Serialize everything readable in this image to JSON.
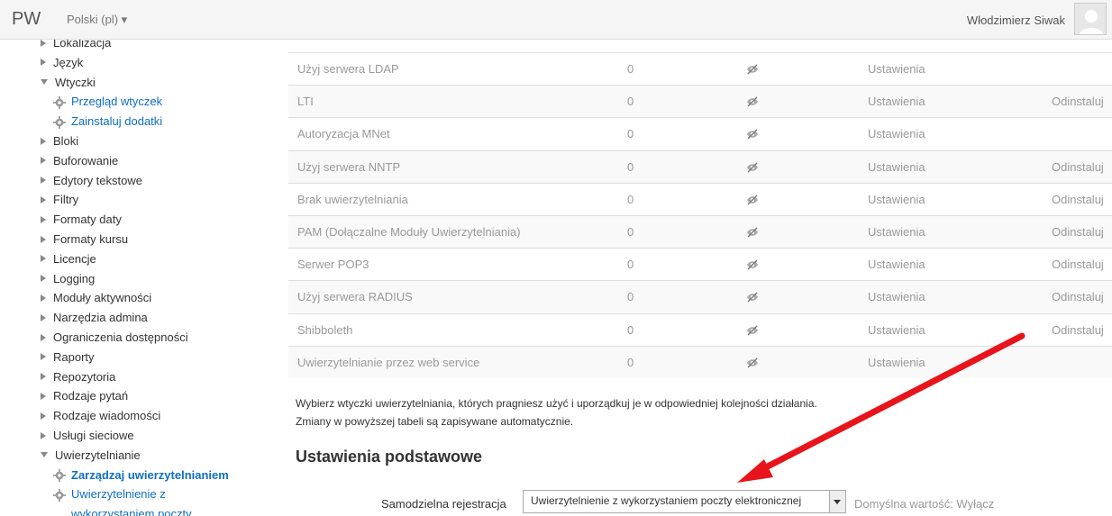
{
  "navbar": {
    "brand": "PW",
    "language": "Polski (pl) ▾",
    "user_name": "Włodzimierz Siwak"
  },
  "sidebar": {
    "items": [
      {
        "label": "Lokalizacja",
        "state": "collapsed"
      },
      {
        "label": "Język",
        "state": "collapsed"
      },
      {
        "label": "Wtyczki",
        "state": "expanded"
      },
      {
        "label": "Przegląd wtyczek",
        "state": "link"
      },
      {
        "label": "Zainstaluj dodatki",
        "state": "link"
      },
      {
        "label": "Bloki",
        "state": "collapsed"
      },
      {
        "label": "Buforowanie",
        "state": "collapsed"
      },
      {
        "label": "Edytory tekstowe",
        "state": "collapsed"
      },
      {
        "label": "Filtry",
        "state": "collapsed"
      },
      {
        "label": "Formaty daty",
        "state": "collapsed"
      },
      {
        "label": "Formaty kursu",
        "state": "collapsed"
      },
      {
        "label": "Licencje",
        "state": "collapsed"
      },
      {
        "label": "Logging",
        "state": "collapsed"
      },
      {
        "label": "Moduły aktywności",
        "state": "collapsed"
      },
      {
        "label": "Narzędzia admina",
        "state": "collapsed"
      },
      {
        "label": "Ograniczenia dostępności",
        "state": "collapsed"
      },
      {
        "label": "Raporty",
        "state": "collapsed"
      },
      {
        "label": "Repozytoria",
        "state": "collapsed"
      },
      {
        "label": "Rodzaje pytań",
        "state": "collapsed"
      },
      {
        "label": "Rodzaje wiadomości",
        "state": "collapsed"
      },
      {
        "label": "Usługi sieciowe",
        "state": "collapsed"
      },
      {
        "label": "Uwierzytelnianie",
        "state": "expanded"
      },
      {
        "label": "Zarządzaj uwierzytelnianiem",
        "state": "active"
      },
      {
        "label": "Uwierzytelnienie z",
        "state": "link"
      },
      {
        "label": "wykorzystaniem poczty",
        "state": "link-continued"
      }
    ]
  },
  "auth_table": {
    "rows": [
      {
        "name": "Użyj serwera LDAP",
        "count": "0",
        "settings": "Ustawienia",
        "uninstall": ""
      },
      {
        "name": "LTI",
        "count": "0",
        "settings": "Ustawienia",
        "uninstall": "Odinstaluj"
      },
      {
        "name": "Autoryzacja MNet",
        "count": "0",
        "settings": "Ustawienia",
        "uninstall": ""
      },
      {
        "name": "Użyj serwera NNTP",
        "count": "0",
        "settings": "Ustawienia",
        "uninstall": "Odinstaluj"
      },
      {
        "name": "Brak uwierzytelniania",
        "count": "0",
        "settings": "Ustawienia",
        "uninstall": "Odinstaluj"
      },
      {
        "name": "PAM (Dołączalne Moduły Uwierzytelniania)",
        "count": "0",
        "settings": "Ustawienia",
        "uninstall": "Odinstaluj"
      },
      {
        "name": "Serwer POP3",
        "count": "0",
        "settings": "Ustawienia",
        "uninstall": "Odinstaluj"
      },
      {
        "name": "Użyj serwera RADIUS",
        "count": "0",
        "settings": "Ustawienia",
        "uninstall": "Odinstaluj"
      },
      {
        "name": "Shibboleth",
        "count": "0",
        "settings": "Ustawienia",
        "uninstall": "Odinstaluj"
      },
      {
        "name": "Uwierzytelnianie przez web service",
        "count": "0",
        "settings": "Ustawienia",
        "uninstall": ""
      }
    ],
    "enable_icon": "eye-slash-icon"
  },
  "notes": {
    "line1": "Wybierz wtyczki uwierzytelniania, których pragniesz użyć i uporządkuj je w odpowiedniej kolejności działania.",
    "line2": "Zmiany w powyższej tabeli są zapisywane automatycznie."
  },
  "basic_settings": {
    "heading": "Ustawienia podstawowe",
    "self_registration_label": "Samodzielna rejestracja",
    "self_registration_value": "Uwierzytelnienie z wykorzystaniem poczty elektronicznej",
    "default_text": "Domyślna wartość: Wyłącz"
  },
  "colors": {
    "link": "#0f6fc5",
    "annotation_arrow": "#e8141c"
  }
}
